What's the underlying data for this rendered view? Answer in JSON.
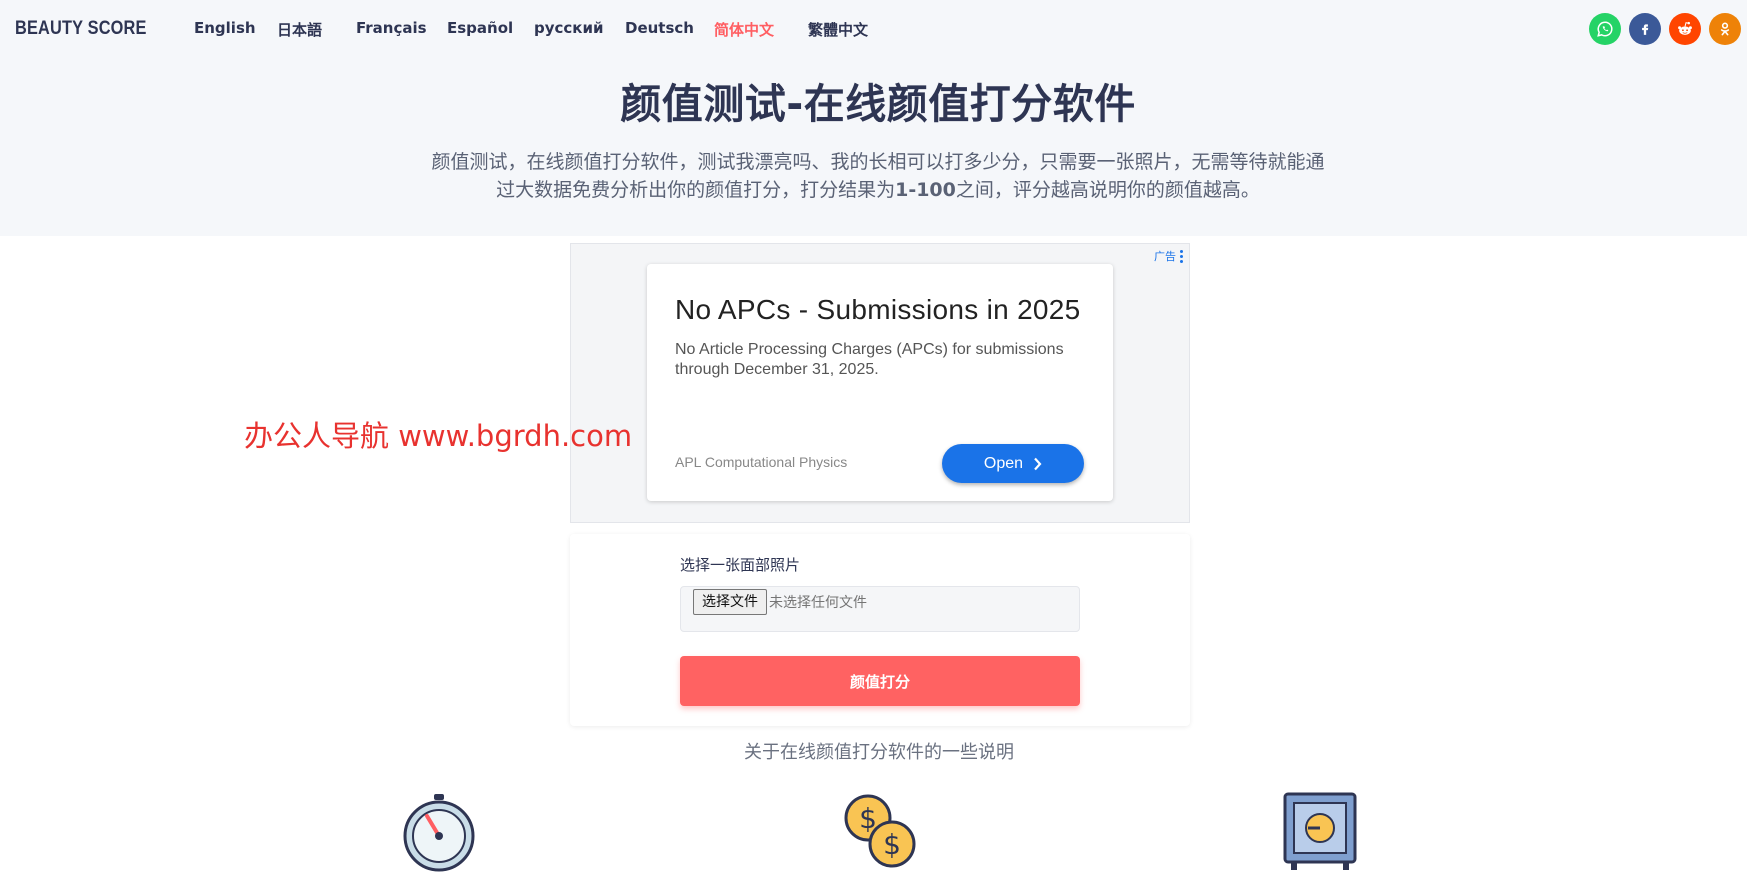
{
  "nav": {
    "brand": "BEAUTY SCORE",
    "languages": [
      "English",
      "日本語",
      "Français",
      "Español",
      "русский",
      "Deutsch",
      "简体中文",
      "繁體中文"
    ],
    "active_language": "简体中文",
    "social": [
      "whatsapp-icon",
      "facebook-icon",
      "reddit-icon",
      "odnoklassniki-icon"
    ],
    "colors": {
      "whatsapp": "#25d366",
      "facebook": "#3b5998",
      "reddit": "#ff4500",
      "odnoklassniki": "#ee8208"
    }
  },
  "hero": {
    "title": "颜值测试-在线颜值打分软件",
    "desc_part1": "颜值测试，在线颜值打分软件，测试我漂亮吗、我的长相可以打多少分，只需要一张照片，无需等待就能通过大数据免费分析出你的颜值打分，打分结果为",
    "desc_bold": "1-100",
    "desc_part2": "之间，评分越高说明你的颜值越高。"
  },
  "ad": {
    "label": "广告",
    "headline": "No APCs - Submissions in 2025",
    "body": "No Article Processing Charges (APCs) for submissions through December 31, 2025.",
    "source": "APL Computational Physics",
    "cta": "Open"
  },
  "watermark": "办公人导航 www.bgrdh.com",
  "form": {
    "label": "选择一张面部照片",
    "file_button": "选择文件",
    "file_status": "未选择任何文件",
    "submit": "颜值打分",
    "accent": "#ff6262"
  },
  "info": {
    "section_title": "关于在线颜值打分软件的一些说明",
    "icons": [
      "stopwatch-icon",
      "coins-icon",
      "safe-icon"
    ]
  }
}
